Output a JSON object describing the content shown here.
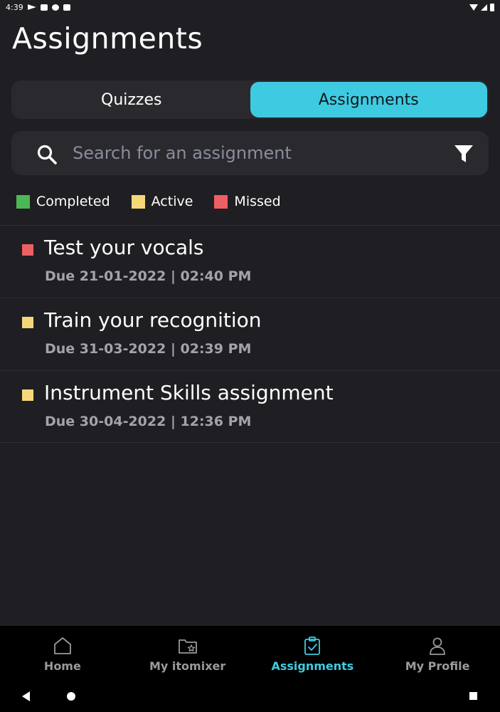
{
  "status_bar": {
    "time": "4:39"
  },
  "page_title": "Assignments",
  "tabs": [
    {
      "label": "Quizzes",
      "active": false
    },
    {
      "label": "Assignments",
      "active": true
    }
  ],
  "search": {
    "placeholder": "Search for an assignment",
    "value": ""
  },
  "legend": [
    {
      "label": "Completed",
      "color": "#4cb854"
    },
    {
      "label": "Active",
      "color": "#f5d77a"
    },
    {
      "label": "Missed",
      "color": "#ec5f62"
    }
  ],
  "assignments": [
    {
      "title": "Test your vocals",
      "due": "Due 21-01-2022 | 02:40 PM",
      "status": "missed",
      "color": "#ec5f62"
    },
    {
      "title": "Train your recognition",
      "due": "Due 31-03-2022 | 02:39 PM",
      "status": "active",
      "color": "#f5d77a"
    },
    {
      "title": "Instrument Skills assignment",
      "due": "Due 30-04-2022 | 12:36 PM",
      "status": "active",
      "color": "#f5d77a"
    }
  ],
  "bottom_nav": [
    {
      "label": "Home",
      "icon": "home-icon",
      "active": false
    },
    {
      "label": "My itomixer",
      "icon": "folder-star-icon",
      "active": false
    },
    {
      "label": "Assignments",
      "icon": "clipboard-check-icon",
      "active": true
    },
    {
      "label": "My Profile",
      "icon": "person-icon",
      "active": false
    }
  ],
  "colors": {
    "accent": "#3ecbe1",
    "background": "#1f1e22",
    "surface": "#2a292e"
  }
}
